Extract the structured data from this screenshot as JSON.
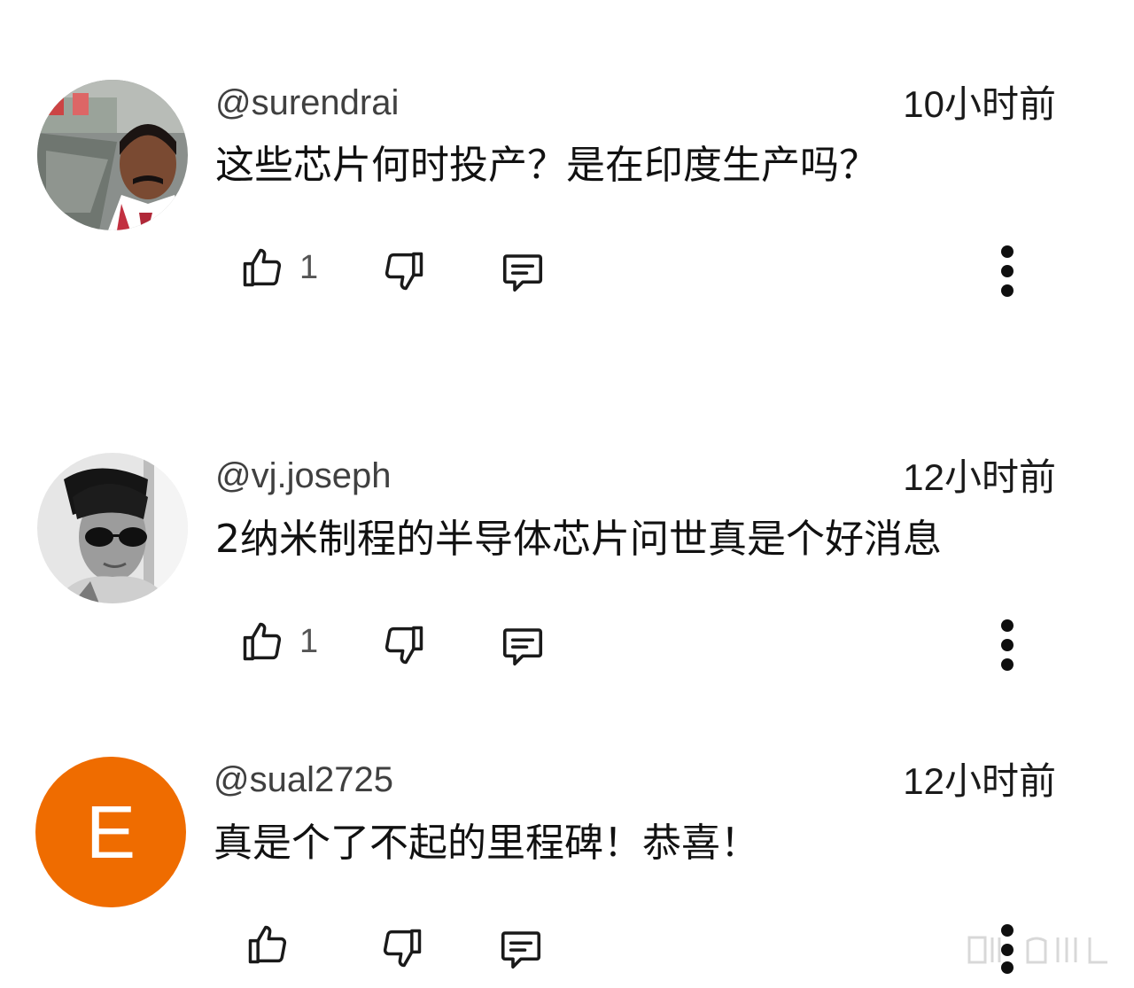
{
  "comments": [
    {
      "username": "@surendrai",
      "time": "10小时前",
      "text": "这些芯片何时投产？是在印度生产吗？",
      "likes": "1",
      "avatar": "photo-man-mustache"
    },
    {
      "username": "@vj.joseph",
      "time": "12小时前",
      "text": "2纳米制程的半导体芯片问世真是个好消息",
      "likes": "1",
      "avatar": "photo-man-sunglasses"
    },
    {
      "username": "@sual2725",
      "time": "12小时前",
      "text": "真是个了不起的里程碑！恭喜！",
      "likes": "",
      "avatar_letter": "E",
      "avatar_color": "#ef6c00"
    }
  ],
  "icons": {
    "like": "thumb-up-icon",
    "dislike": "thumb-down-icon",
    "reply": "comment-icon",
    "more": "more-vert-icon"
  },
  "colors": {
    "text": "#0f0f0f",
    "secondary": "#404040",
    "orange_avatar": "#ef6c00"
  }
}
